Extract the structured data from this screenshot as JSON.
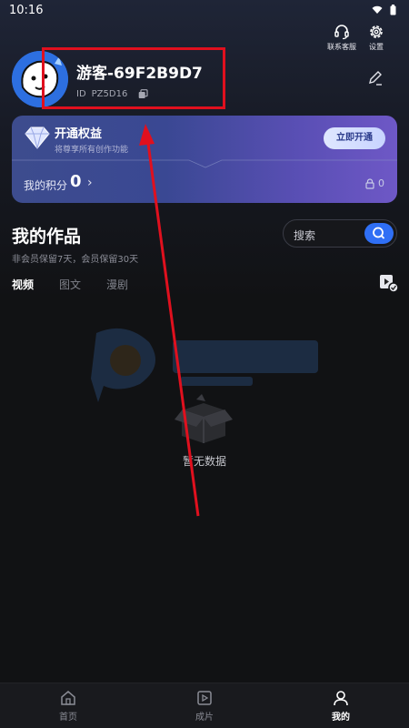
{
  "status_bar": {
    "time": "10:16"
  },
  "header": {
    "customer_service_label": "联系客服",
    "settings_label": "设置"
  },
  "profile": {
    "username": "游客-69F2B9D7",
    "id_label": "ID",
    "id_value": "PZ5D16"
  },
  "vip_card": {
    "title": "开通权益",
    "subtitle": "将尊享所有创作功能",
    "button_label": "立即开通",
    "points_label": "我的积分",
    "points_value": "0",
    "locked_count": "0"
  },
  "works": {
    "title": "我的作品",
    "retention_note": "非会员保留7天，会员保留30天",
    "search_placeholder": "搜索",
    "tabs": [
      "视频",
      "图文",
      "漫剧"
    ],
    "active_tab": "视频",
    "empty_text": "暂无数据"
  },
  "bottom_nav": {
    "items": [
      {
        "label": "首页",
        "icon": "home-icon"
      },
      {
        "label": "成片",
        "icon": "film-icon"
      },
      {
        "label": "我的",
        "icon": "profile-icon"
      }
    ],
    "active": "我的"
  },
  "colors": {
    "accent_blue": "#2f6ff5",
    "annotation_red": "#e0101e",
    "vip_gradient_start": "#3d4c8e",
    "vip_gradient_end": "#6e58c6"
  }
}
